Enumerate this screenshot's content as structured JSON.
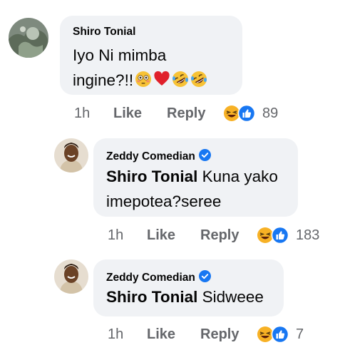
{
  "comments": [
    {
      "author": "Shiro Tonial",
      "verified": false,
      "mention": "",
      "text_line1": "Iyo Ni mimba",
      "text_line2": "ingine?!!",
      "emojis": [
        "flushed-face",
        "red-heart",
        "rolling-on-floor-laughing",
        "rolling-on-floor-laughing"
      ],
      "time": "1h",
      "like_label": "Like",
      "reply_label": "Reply",
      "reactions": [
        "haha",
        "like"
      ],
      "reaction_count": "89"
    },
    {
      "author": "Zeddy Comedian",
      "verified": true,
      "mention": "Shiro Tonial",
      "text_line1": " Kuna yako",
      "text_line2": "imepotea?seree",
      "time": "1h",
      "like_label": "Like",
      "reply_label": "Reply",
      "reactions": [
        "haha",
        "like"
      ],
      "reaction_count": "183"
    },
    {
      "author": "Zeddy Comedian",
      "verified": true,
      "mention": "Shiro Tonial",
      "text_line1": " Sidweee",
      "time": "1h",
      "like_label": "Like",
      "reply_label": "Reply",
      "reactions": [
        "haha",
        "like"
      ],
      "reaction_count": "7"
    }
  ],
  "colors": {
    "bubble": "#f0f2f5",
    "meta_text": "#65676b",
    "like_blue": "#1877f2",
    "haha_yellow": "#f7b125"
  }
}
